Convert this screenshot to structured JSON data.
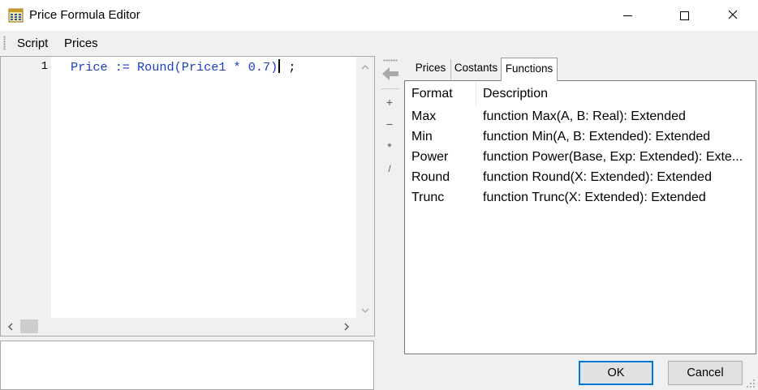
{
  "window": {
    "title": "Price Formula Editor",
    "minimize_symbol": "—",
    "icon": "calculator-grid-icon"
  },
  "menu": {
    "items": [
      {
        "label": "Script"
      },
      {
        "label": "Prices"
      }
    ]
  },
  "editor": {
    "line_numbers": [
      "1"
    ],
    "code_tokens": {
      "t0": "Price",
      "t1": " := ",
      "t2": "Round",
      "t3": "(",
      "t4": "Price1",
      "t5": " * ",
      "t6": "0.7",
      "t7": ")",
      "t8": " ;"
    },
    "code_color": "#1a3cc8"
  },
  "operators": {
    "items": [
      "+",
      "−",
      "*",
      "/"
    ],
    "insert_icon": "arrow-left-icon"
  },
  "tabs": {
    "items": [
      {
        "label": "Prices"
      },
      {
        "label": "Costants"
      },
      {
        "label": "Functions"
      }
    ],
    "active": "Functions"
  },
  "functions": {
    "header_format": "Format",
    "header_description": "Description",
    "rows": [
      {
        "name": "Max",
        "description": "function Max(A, B: Real): Extended"
      },
      {
        "name": "Min",
        "description": "function Min(A, B: Extended): Extended"
      },
      {
        "name": "Power",
        "description": "function Power(Base, Exp: Extended): Exte..."
      },
      {
        "name": "Round",
        "description": "function Round(X: Extended): Extended"
      },
      {
        "name": "Trunc",
        "description": "function Trunc(X: Extended): Extended"
      }
    ]
  },
  "buttons": {
    "ok": "OK",
    "cancel": "Cancel"
  },
  "colors": {
    "ok_border": "#0078d7",
    "background": "#f0f0f0"
  }
}
